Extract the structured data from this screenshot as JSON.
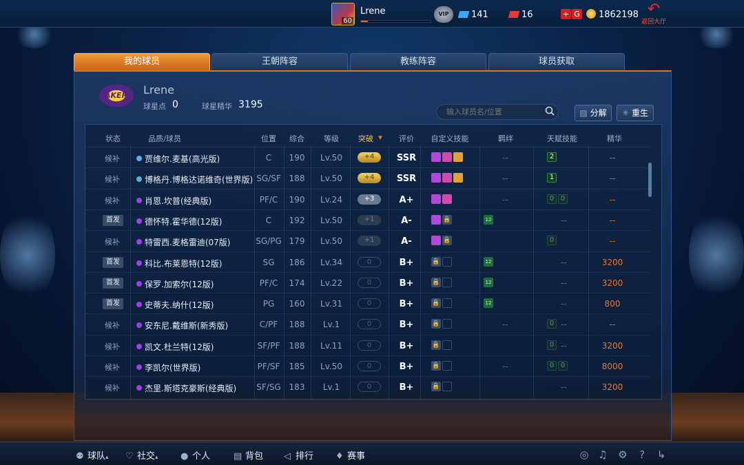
{
  "topbar": {
    "level": "60",
    "username": "Lrene",
    "xp_fraction": 0.1,
    "vip_label": "VIP",
    "tickets_blue": "141",
    "tickets_red": "16",
    "gold": "1862198",
    "return_label": "返回大厅"
  },
  "tabs": [
    {
      "label": "我的球员",
      "active": true
    },
    {
      "label": "王朝阵容",
      "active": false
    },
    {
      "label": "教练阵容",
      "active": false
    },
    {
      "label": "球员获取",
      "active": false
    }
  ],
  "profile": {
    "team_logo_text": "LAKERS",
    "name": "Lrene",
    "points_label": "球星点",
    "points_value": "0",
    "essence_label": "球星精华",
    "essence_value": "3195"
  },
  "search": {
    "placeholder": "输入球员名/位置"
  },
  "actions": {
    "decompose": "分解",
    "rebirth": "重生"
  },
  "columns": {
    "status": "状态",
    "player": "品质/球员",
    "position": "位置",
    "overall": "综合",
    "level": "等级",
    "breakthrough": "突破",
    "grade": "评价",
    "skills": "自定义技能",
    "bonds": "羁绊",
    "talents": "天赋技能",
    "essence": "精华"
  },
  "players": [
    {
      "status": "候补",
      "starter": false,
      "quality": "blue",
      "name": "贾维尔.麦基(高光版)",
      "position": "C",
      "overall": "190",
      "level": "Lv.50",
      "breakthrough": "+4",
      "grade": "SSR",
      "skills": 3,
      "locks": 0,
      "bond": "--",
      "bond_num": "",
      "talent": "2",
      "talent_empty": 0,
      "essence": "--"
    },
    {
      "status": "候补",
      "starter": false,
      "quality": "blue",
      "name": "博格丹.博格达诺维奇(世界版)",
      "position": "SG/SF",
      "overall": "188",
      "level": "Lv.50",
      "breakthrough": "+4",
      "grade": "SSR",
      "skills": 3,
      "locks": 0,
      "bond": "--",
      "bond_num": "",
      "talent": "1",
      "talent_empty": 0,
      "essence": "--"
    },
    {
      "status": "候补",
      "starter": false,
      "quality": "purple",
      "name": "肖恩.坎普(经典版)",
      "position": "PF/C",
      "overall": "190",
      "level": "Lv.24",
      "breakthrough": "+3",
      "grade": "A+",
      "skills": 2,
      "locks": 0,
      "bond": "--",
      "bond_num": "",
      "talent": "",
      "talent_empty": 2,
      "essence": "--"
    },
    {
      "status": "首发",
      "starter": true,
      "quality": "purple",
      "name": "德怀特.霍华德(12版)",
      "position": "C",
      "overall": "192",
      "level": "Lv.50",
      "breakthrough": "+1",
      "grade": "A-",
      "skills": 1,
      "locks": 1,
      "bond": "",
      "bond_num": "12",
      "talent": "--",
      "talent_empty": 0,
      "essence": "--"
    },
    {
      "status": "候补",
      "starter": false,
      "quality": "purple",
      "name": "特雷西.麦格雷迪(07版)",
      "position": "SG/PG",
      "overall": "179",
      "level": "Lv.50",
      "breakthrough": "+1",
      "grade": "A-",
      "skills": 1,
      "locks": 1,
      "bond": "",
      "bond_num": "",
      "talent": "",
      "talent_empty": 1,
      "essence": "--"
    },
    {
      "status": "首发",
      "starter": true,
      "quality": "purple",
      "name": "科比.布莱恩特(12版)",
      "position": "SG",
      "overall": "186",
      "level": "Lv.34",
      "breakthrough": "0",
      "grade": "B+",
      "skills": 0,
      "locks": 2,
      "bond": "",
      "bond_num": "12",
      "talent": "--",
      "talent_empty": 0,
      "essence": "3200"
    },
    {
      "status": "首发",
      "starter": true,
      "quality": "purple",
      "name": "保罗.加索尔(12版)",
      "position": "PF/C",
      "overall": "174",
      "level": "Lv.22",
      "breakthrough": "0",
      "grade": "B+",
      "skills": 0,
      "locks": 2,
      "bond": "",
      "bond_num": "12",
      "talent": "--",
      "talent_empty": 0,
      "essence": "3200"
    },
    {
      "status": "首发",
      "starter": true,
      "quality": "purple",
      "name": "史蒂夫.纳什(12版)",
      "position": "PG",
      "overall": "160",
      "level": "Lv.31",
      "breakthrough": "0",
      "grade": "B+",
      "skills": 0,
      "locks": 2,
      "bond": "",
      "bond_num": "12",
      "talent": "--",
      "talent_empty": 0,
      "essence": "800"
    },
    {
      "status": "候补",
      "starter": false,
      "quality": "purple",
      "name": "安东尼.戴维斯(新秀版)",
      "position": "C/PF",
      "overall": "188",
      "level": "Lv.1",
      "breakthrough": "0",
      "grade": "B+",
      "skills": 0,
      "locks": 2,
      "bond": "--",
      "bond_num": "",
      "talent": "--",
      "talent_empty": 1,
      "essence": "--"
    },
    {
      "status": "候补",
      "starter": false,
      "quality": "purple",
      "name": "凯文.杜兰特(12版)",
      "position": "SF/PF",
      "overall": "188",
      "level": "Lv.11",
      "breakthrough": "0",
      "grade": "B+",
      "skills": 0,
      "locks": 2,
      "bond": "",
      "bond_num": "",
      "talent": "--",
      "talent_empty": 1,
      "essence": "3200"
    },
    {
      "status": "候补",
      "starter": false,
      "quality": "purple",
      "name": "李凯尔(世界版)",
      "position": "PF/SF",
      "overall": "185",
      "level": "Lv.50",
      "breakthrough": "0",
      "grade": "B+",
      "skills": 0,
      "locks": 2,
      "bond": "--",
      "bond_num": "",
      "talent": "",
      "talent_empty": 2,
      "essence": "8000"
    },
    {
      "status": "候补",
      "starter": false,
      "quality": "purple",
      "name": "杰里.斯塔克豪斯(经典版)",
      "position": "SF/SG",
      "overall": "183",
      "level": "Lv.1",
      "breakthrough": "0",
      "grade": "B+",
      "skills": 0,
      "locks": 2,
      "bond": "",
      "bond_num": "",
      "talent": "--",
      "talent_empty": 0,
      "essence": "3200"
    }
  ],
  "bottom_nav": [
    {
      "label": "球队",
      "icon": "person-icon",
      "caret": true
    },
    {
      "label": "社交",
      "icon": "heart-icon",
      "caret": true
    },
    {
      "label": "个人",
      "icon": "user-icon",
      "caret": false
    },
    {
      "label": "背包",
      "icon": "bag-icon",
      "caret": false
    },
    {
      "label": "排行",
      "icon": "megaphone-icon",
      "caret": false
    },
    {
      "label": "赛事",
      "icon": "trophy-icon",
      "caret": false
    }
  ],
  "colors": {
    "accent": "#e8852e",
    "quality_blue": "#5aaee6",
    "quality_purple": "#9a42e6",
    "essence": "#e37a3a",
    "breakthrough_gold": "#e0b23a"
  }
}
